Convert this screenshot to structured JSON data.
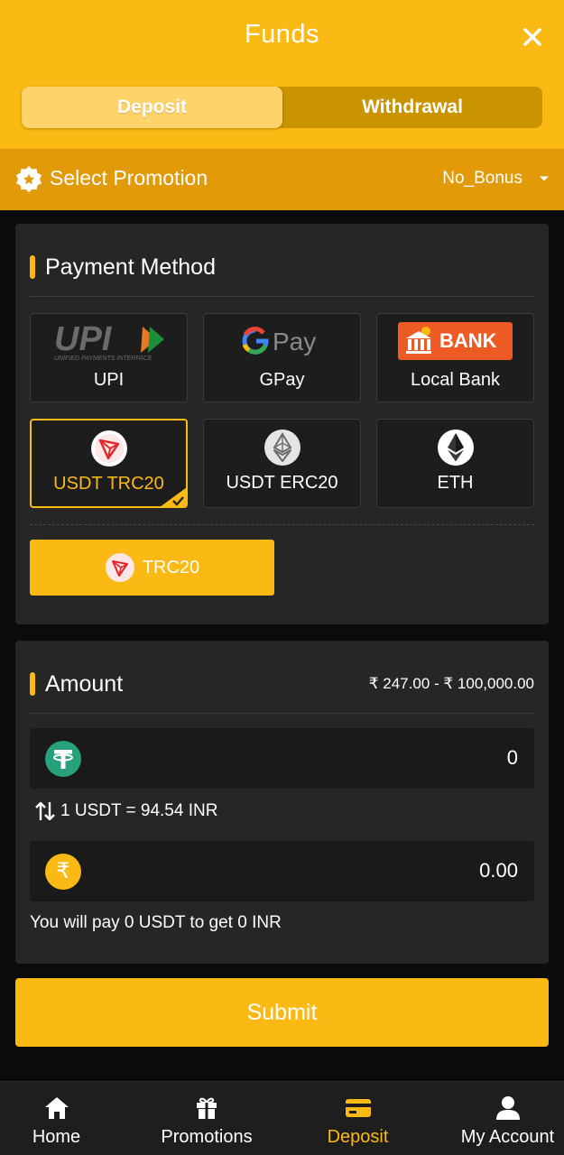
{
  "header": {
    "title": "Funds",
    "tabs": [
      {
        "label": "Deposit",
        "active": true
      },
      {
        "label": "Withdrawal",
        "active": false
      }
    ]
  },
  "promotion": {
    "label": "Select Promotion",
    "selected": "No_Bonus"
  },
  "payment": {
    "title": "Payment Method",
    "methods": [
      {
        "label": "UPI",
        "logo_text": "UPI",
        "logo_subtext": "UNIFIED PAYMENTS INTERFACE"
      },
      {
        "label": "GPay",
        "logo_text": "Pay"
      },
      {
        "label": "Local Bank",
        "logo_text": "BANK"
      },
      {
        "label": "USDT TRC20",
        "selected": true
      },
      {
        "label": "USDT ERC20"
      },
      {
        "label": "ETH"
      }
    ],
    "network": "TRC20"
  },
  "amount": {
    "title": "Amount",
    "range": "₹ 247.00 - ₹ 100,000.00",
    "usdt_value": "0",
    "rate": "1 USDT = 94.54 INR",
    "inr_value": "0.00",
    "inr_symbol": "₹",
    "note": "You will pay 0 USDT to get 0 INR"
  },
  "submit_label": "Submit",
  "nav": [
    {
      "label": "Home",
      "icon": "home-icon"
    },
    {
      "label": "Promotions",
      "icon": "gift-icon"
    },
    {
      "label": "Deposit",
      "icon": "card-icon",
      "active": true
    },
    {
      "label": "My Account",
      "icon": "user-icon"
    }
  ],
  "colors": {
    "accent": "#fbb913",
    "promo_bar": "#e39a08",
    "card": "#262626",
    "background": "#0b0b0b"
  }
}
